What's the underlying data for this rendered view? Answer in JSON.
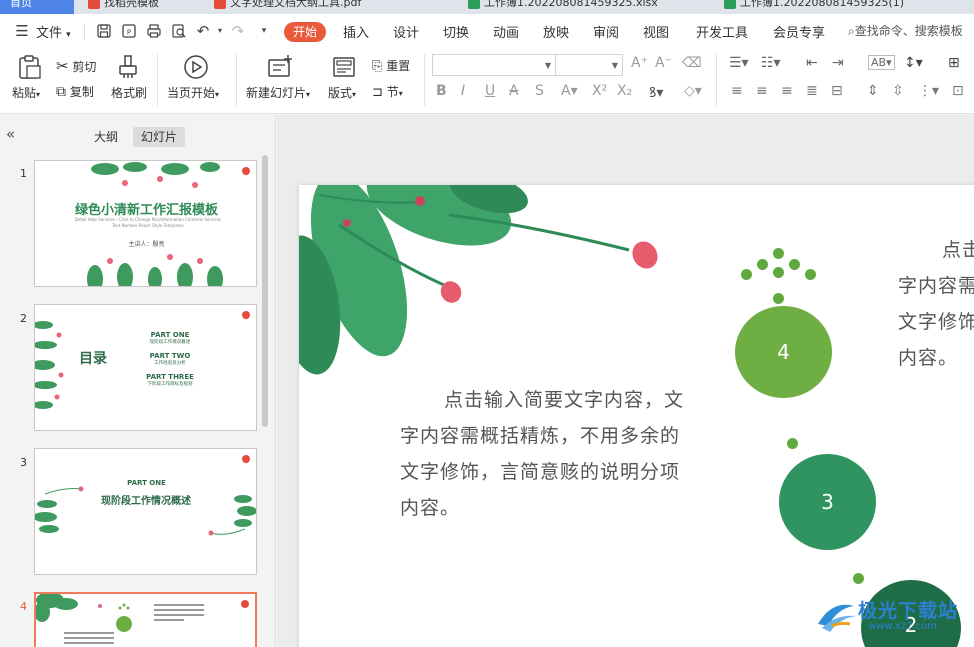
{
  "doc_tabs": [
    {
      "label": "首页",
      "active": true
    },
    {
      "label": "找稻壳模板",
      "color": "#e64a3a"
    },
    {
      "label": "文字处理文档大纲工具.pdf",
      "color": "#e64a3a"
    },
    {
      "label": "工作簿1.202208081459325.xlsx",
      "color": "#2d9d5a"
    },
    {
      "label": "工作簿1.202208081459325(1)",
      "color": "#2d9d5a"
    }
  ],
  "menu": {
    "file": "文件",
    "items": [
      "开始",
      "插入",
      "设计",
      "切换",
      "动画",
      "放映",
      "审阅",
      "视图",
      "开发工具",
      "会员专享"
    ],
    "active": "开始",
    "search": "查找命令、搜索模板"
  },
  "ribbon": {
    "paste": "粘贴",
    "cut": "剪切",
    "copy": "复制",
    "format_painter": "格式刷",
    "from_current": "当页开始",
    "new_slide": "新建幻灯片",
    "layout": "版式",
    "reset": "重置",
    "section": "节"
  },
  "left_pane": {
    "collapse": "«",
    "tab_outline": "大纲",
    "tab_slides": "幻灯片",
    "active_tab": "幻灯片"
  },
  "thumbnails": [
    {
      "num": "1",
      "title": "绿色小清新工作汇报模板",
      "sub": "Detail Help Services / Click to Change Pics/Information Contents Services Text Number Peach Style Templates",
      "presenter": "主讲人：殷亮"
    },
    {
      "num": "2",
      "title": "目录",
      "parts": [
        {
          "head": "PART ONE",
          "desc": "现阶段工作情况概述"
        },
        {
          "head": "PART TWO",
          "desc": "工作经验及分析"
        },
        {
          "head": "PART THREE",
          "desc": "下阶段工作目标及规划"
        }
      ]
    },
    {
      "num": "3",
      "head": "PART ONE",
      "title": "现阶段工作情况概述"
    },
    {
      "num": "4",
      "selected": true
    }
  ],
  "slide": {
    "text_left": "点击输入简要文字内容，文字内容需概括精炼，不用多余的文字修饰，言简意赅的说明分项内容。",
    "text_right": "点击输入简要文字内容，文字内容需概括精炼，不用多余的文字修饰，言简意赅的说明分项内容。",
    "circles": [
      "4",
      "3",
      "2"
    ]
  },
  "colors": {
    "accent": "#e85a3a",
    "green_light": "#6fae42",
    "green_mid": "#2f9460",
    "green_dark": "#1e6d47"
  },
  "watermark": {
    "text": "极光下载站",
    "url": "www.xz7.com"
  }
}
